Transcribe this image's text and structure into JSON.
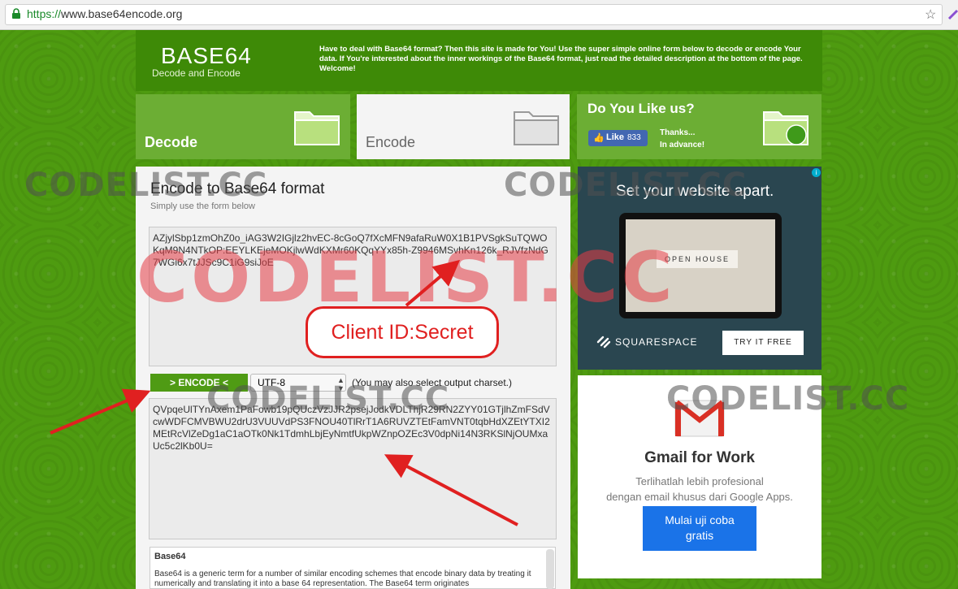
{
  "browser": {
    "url_scheme": "https://",
    "url_rest": "www.base64encode.org"
  },
  "header": {
    "logo_title": "BASE64",
    "logo_subtitle": "Decode and Encode",
    "intro": "Have to deal with Base64 format? Then this site is made for You! Use the super simple online form below to decode or encode Your data. If You're interested about the inner workings of the Base64 format, just read the detailed description at the bottom of the page. Welcome!"
  },
  "tabs": [
    {
      "label": "Decode"
    },
    {
      "label": "Encode"
    }
  ],
  "like_box": {
    "title": "Do You Like us?",
    "fb_label": "Like",
    "fb_count": "833",
    "thanks_line1": "Thanks...",
    "thanks_line2": "In advance!"
  },
  "main": {
    "title": "Encode to Base64 format",
    "subtitle": "Simply use the form below",
    "input_value": "AZjylSbp1zmOhZ0o_iAG3W2IGjlz2hvEC-8cGoQ7fXcMFN9afaRuW0X1B1PVSgkSuTQWOKqM9N4NTkOP:EEYLKEjeMOKjlwWdKXMr60KQqYYx85h-Z9946MSvhKn126k_RJVfzNdG7WGi6x7tJJSc9C1iG9siJoE",
    "encode_button": "> ENCODE <",
    "charset_value": "UTF-8",
    "charset_note": "(You may also select output charset.)",
    "output_value": "QVpqeUlTYnAxem1PaFowb19pQUczVzJJR2psejJodkVDLThjR29RN2ZYY01GTjlhZmFSdVcwWDFCMVBWU2drU3VUUVdPS3FNOU40TlRrT1A6RUVZTEtFamVNT0tqbHdXZEtYTXI2MEtRcVlZeDg1aC1aOTk0Nk1TdmhLbjEyNmtfUkpWZnpOZEc3V0dpNi14N3RKSlNjOUMxaUc5c2lKb0U=",
    "info_title": "Base64",
    "info_text": "Base64 is a generic term for a number of similar encoding schemes that encode binary data by treating it numerically and translating it into a base 64 representation. The Base64 term originates"
  },
  "ad_squarespace": {
    "headline": "Set your website apart.",
    "open_house": "OPEN HOUSE",
    "brand": "SQUARESPACE",
    "cta": "TRY IT FREE",
    "info_icon": "i"
  },
  "ad_gmail": {
    "title": "Gmail for Work",
    "desc_line1": "Terlihatlah lebih profesional",
    "desc_line2": "dengan email khusus dari Google Apps.",
    "cta_line1": "Mulai uji coba",
    "cta_line2": "gratis"
  },
  "annotations": {
    "callout": "Client ID:Secret",
    "watermark": "CODELIST.CC",
    "watermark_big": "CODELIST.CC"
  },
  "colors": {
    "page_green": "#4e9b10",
    "tab_green": "#6cae34",
    "button_green": "#4f9b14",
    "annotation_red": "#e02020"
  }
}
